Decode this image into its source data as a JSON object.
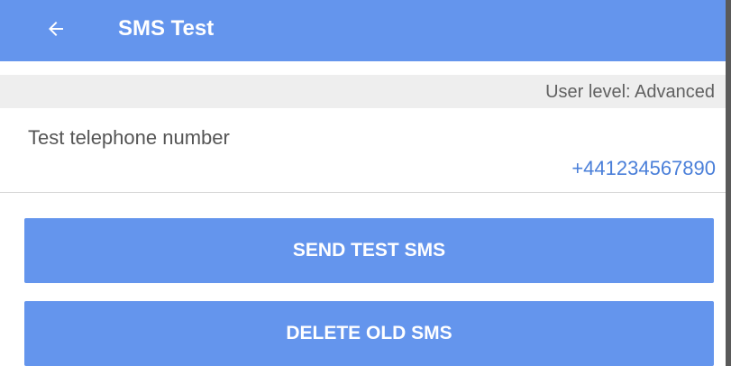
{
  "header": {
    "back_icon": "arrow-left-icon",
    "title": "SMS Test"
  },
  "status": {
    "user_level": "User level: Advanced"
  },
  "phone_field": {
    "label": "Test telephone number",
    "value": "+441234567890"
  },
  "actions": {
    "send_label": "SEND TEST SMS",
    "delete_label": "DELETE OLD SMS"
  },
  "colors": {
    "primary": "#6495ed",
    "accent_text": "#4a7fd9",
    "status_bar_bg": "#eeeeee"
  }
}
